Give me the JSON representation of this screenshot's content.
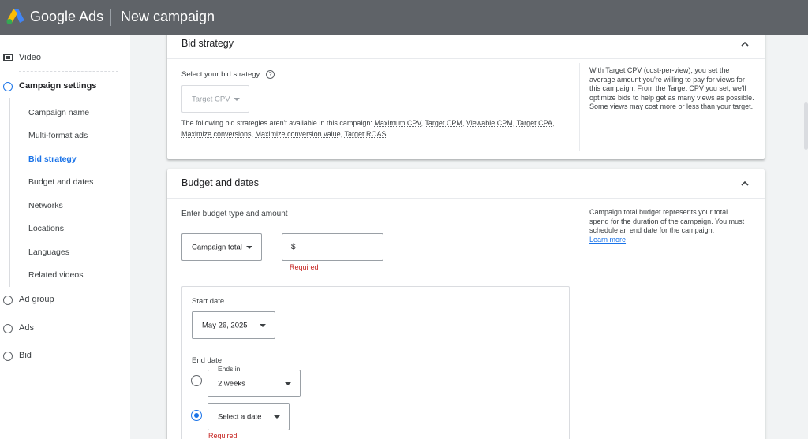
{
  "header": {
    "brand": "Google Ads",
    "title": "New campaign",
    "colors": {
      "bar": "#5f6368",
      "logo_blue": "#4285f4",
      "logo_yellow": "#fbbc04",
      "logo_green": "#34a853"
    }
  },
  "sidebar": {
    "video": "Video",
    "campaign_settings": "Campaign settings",
    "sub_items": [
      {
        "label": "Campaign name",
        "active": false
      },
      {
        "label": "Multi-format ads",
        "active": false
      },
      {
        "label": "Bid strategy",
        "active": true
      },
      {
        "label": "Budget and dates",
        "active": false
      },
      {
        "label": "Networks",
        "active": false
      },
      {
        "label": "Locations",
        "active": false
      },
      {
        "label": "Languages",
        "active": false
      },
      {
        "label": "Related videos",
        "active": false
      }
    ],
    "steps": [
      "Ad group",
      "Ads",
      "Bid"
    ]
  },
  "bid_strategy": {
    "title": "Bid strategy",
    "select_label": "Select your bid strategy",
    "help_icon": "?",
    "dropdown_value": "Target CPV",
    "unavailable_intro": "The following bid strategies aren't available in this campaign: ",
    "unavailable": [
      "Maximum CPV",
      "Target CPM",
      "Viewable CPM",
      "Target CPA",
      "Maximize conversions",
      "Maximize conversion value",
      "Target ROAS"
    ],
    "aside": "With Target CPV (cost-per-view), you set the average amount you're willing to pay for views for this campaign. From the Target CPV you set, we'll optimize bids to help get as many views as possible. Some views may cost more or less than your target."
  },
  "budget": {
    "title": "Budget and dates",
    "type_label": "Enter budget type and amount",
    "type_value": "Campaign total",
    "currency": "$",
    "required": "Required",
    "aside": "Campaign total budget represents your total spend for the duration of the campaign. You must schedule an end date for the campaign.",
    "aside_link": "Learn more",
    "start_date_label": "Start date",
    "start_date_value": "May 26, 2025",
    "end_date_label": "End date",
    "ends_in_label": "Ends in",
    "ends_in_value": "2 weeks",
    "select_date_value": "Select a date",
    "end_required": "Required"
  }
}
